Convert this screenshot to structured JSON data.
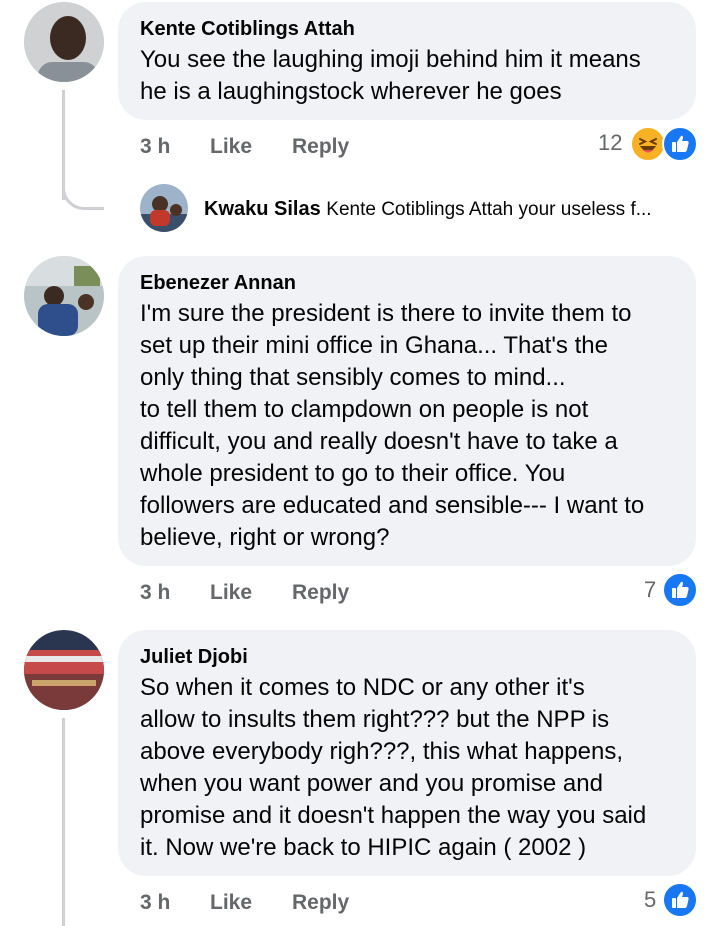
{
  "comments": [
    {
      "author": "Kente Cotiblings Attah",
      "text": "You see the laughing imoji behind him it means\nhe is a laughingstock wherever he goes",
      "time": "3 h",
      "like_label": "Like",
      "reply_label": "Reply",
      "reactions_count": "12",
      "reactions": [
        "haha-icon",
        "like-icon"
      ]
    },
    {
      "author": "Ebenezer Annan",
      "text": "I'm sure the president is there to invite them to\nset up their mini office in Ghana... That's the\nonly thing that sensibly comes to mind...\nto tell them to clampdown on people is not\ndifficult, you and really  doesn't have to take a\nwhole president to go to their office. You\nfollowers are educated and sensible--- I want to\nbelieve, right or wrong?",
      "time": "3 h",
      "like_label": "Like",
      "reply_label": "Reply",
      "reactions_count": "7",
      "reactions": [
        "like-icon"
      ]
    },
    {
      "author": "Juliet Djobi",
      "text": "So when it comes to NDC or any other  it's\nallow to insults them right???  but the NPP is\nabove  everybody righ???, this what happens,\nwhen you want power and you promise and\npromise and it doesn't happen the way you said\nit.  Now we're back to HIPIC again ( 2002 )",
      "time": "3 h",
      "like_label": "Like",
      "reply_label": "Reply",
      "reactions_count": "5",
      "reactions": [
        "like-icon"
      ]
    }
  ],
  "reply_preview": {
    "author": "Kwaku Silas",
    "text": "Kente Cotiblings Attah your useless f..."
  },
  "colors": {
    "bubble": "#f0f2f5",
    "meta_text": "#65676b",
    "like_blue": "#1877f2",
    "haha_yellow": "#f7b125",
    "thread_line": "#ced0d4"
  }
}
